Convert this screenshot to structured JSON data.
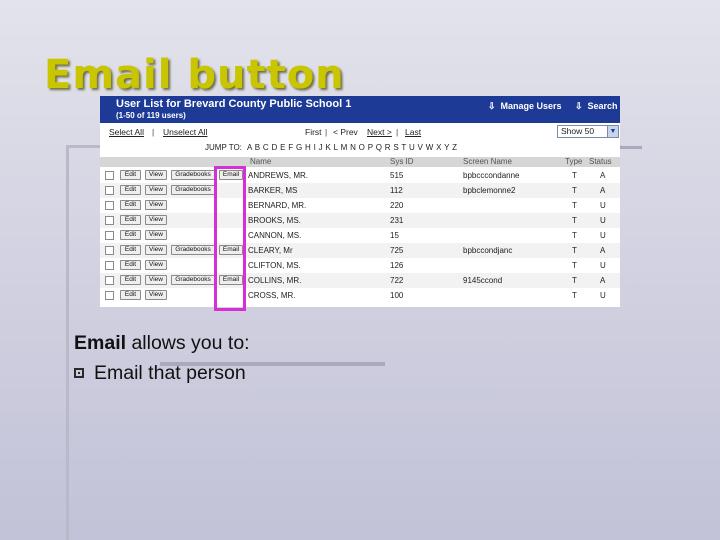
{
  "slide": {
    "title": "Email button",
    "caption_bold": "Email",
    "caption_rest": " allows you to:",
    "bullets": [
      "Email that person"
    ]
  },
  "screenshot": {
    "title": "User List for Brevard County Public School 1",
    "subtitle": "(1-50 of 119 users)",
    "actions": {
      "manage_users": "Manage Users",
      "search": "Search"
    },
    "controls": {
      "select_all": "Select All",
      "unselect_all": "Unselect All",
      "first": "First",
      "prev": "< Prev",
      "next": "Next >",
      "last": "Last",
      "sep": "|",
      "show": "Show 50"
    },
    "jump": {
      "label": "JUMP TO:",
      "letters": "A B C D E F G H I J K L M N O P Q R S T U V W X Y Z"
    },
    "columns": {
      "name": "Name",
      "sys_id": "Sys ID",
      "screen_name": "Screen Name",
      "type": "Type",
      "status": "Status"
    },
    "buttons": {
      "edit": "Edit",
      "view": "View",
      "gradebooks": "Gradebooks",
      "email": "Email"
    },
    "rows": [
      {
        "name": "ANDREWS, MR.",
        "sys_id": "515",
        "screen": "bpbcccondanne",
        "type": "T",
        "status": "A",
        "grade": true,
        "email": true
      },
      {
        "name": "BARKER, MS",
        "sys_id": "112",
        "screen": "bpbclemonne2",
        "type": "T",
        "status": "A",
        "grade": true,
        "email": false
      },
      {
        "name": "BERNARD, MR.",
        "sys_id": "220",
        "screen": "",
        "type": "T",
        "status": "U",
        "grade": false,
        "email": false
      },
      {
        "name": "BROOKS, MS.",
        "sys_id": "231",
        "screen": "",
        "type": "T",
        "status": "U",
        "grade": false,
        "email": false
      },
      {
        "name": "CANNON, MS.",
        "sys_id": "15",
        "screen": "",
        "type": "T",
        "status": "U",
        "grade": false,
        "email": false
      },
      {
        "name": "CLEARY, Mr",
        "sys_id": "725",
        "screen": "bpbccondjanc",
        "type": "T",
        "status": "A",
        "grade": true,
        "email": true
      },
      {
        "name": "CLIFTON, MS.",
        "sys_id": "126",
        "screen": "",
        "type": "T",
        "status": "U",
        "grade": false,
        "email": false
      },
      {
        "name": "COLLINS, MR.",
        "sys_id": "722",
        "screen": "9145ccond",
        "type": "T",
        "status": "A",
        "grade": true,
        "email": true
      },
      {
        "name": "CROSS, MR.",
        "sys_id": "100",
        "screen": "",
        "type": "T",
        "status": "U",
        "grade": false,
        "email": false
      }
    ]
  }
}
